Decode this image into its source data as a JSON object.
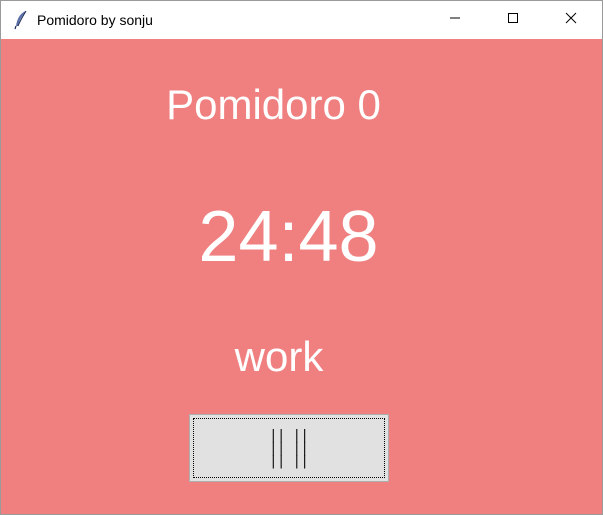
{
  "window": {
    "title": "Pomidoro by sonju",
    "icon": "feather-icon"
  },
  "titlebar_controls": {
    "minimize_icon": "minimize-icon",
    "maximize_icon": "maximize-icon",
    "close_icon": "close-icon"
  },
  "pomodoro": {
    "counter_label": "Pomidoro 0",
    "time_remaining": "24:48",
    "mode": "work",
    "pause_button_label": "|| ||\n|| ||\n|| ||"
  },
  "colors": {
    "background": "#f08080",
    "text": "#ffffff",
    "button": "#e1e1e1"
  }
}
